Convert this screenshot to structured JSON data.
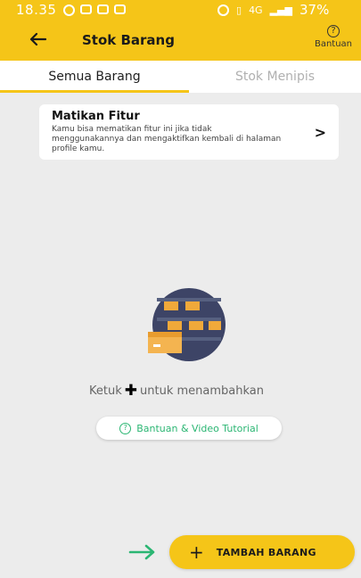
{
  "status_bar": {
    "time": "18.35",
    "network": "4G",
    "battery": "37%"
  },
  "app_bar": {
    "title": "Stok Barang",
    "help_label": "Bantuan"
  },
  "tabs": [
    {
      "label": "Semua Barang",
      "active": true
    },
    {
      "label": "Stok Menipis",
      "active": false
    }
  ],
  "feature_card": {
    "title": "Matikan Fitur",
    "description": "Kamu bisa mematikan fitur ini jika tidak menggunakannya dan mengaktifkan kembali di halaman profile kamu."
  },
  "empty_state": {
    "hint_prefix": "Ketuk",
    "hint_suffix": "untuk menambahkan",
    "tutorial_button": "Bantuan & Video Tutorial"
  },
  "fab": {
    "label": "TAMBAH BARANG"
  },
  "colors": {
    "brand_yellow": "#f5c518",
    "accent_green": "#2bb673"
  }
}
